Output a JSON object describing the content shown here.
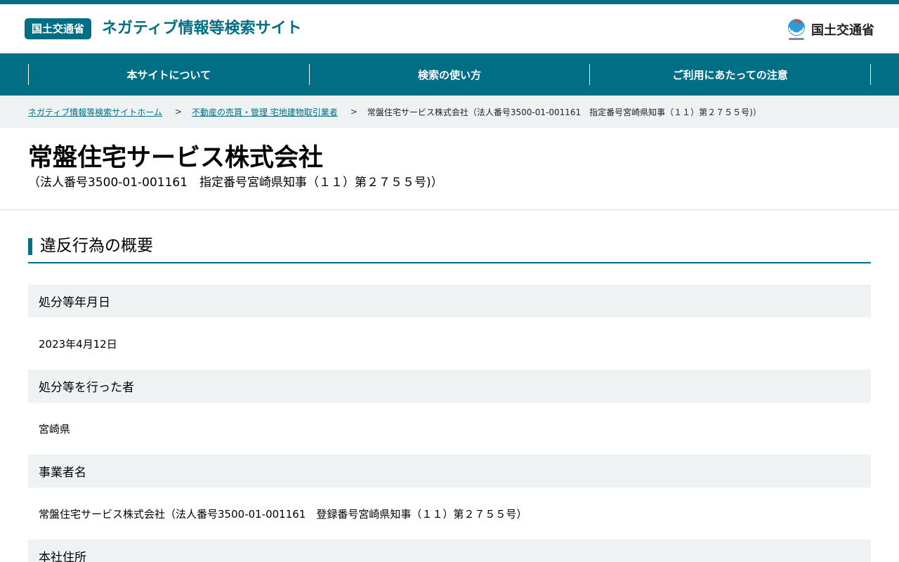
{
  "header": {
    "badge": "国土交通省",
    "site_title": "ネガティブ情報等検索サイト",
    "logo_text": "国土交通省"
  },
  "nav": {
    "items": [
      {
        "label": "本サイトについて"
      },
      {
        "label": "検索の使い方"
      },
      {
        "label": "ご利用にあたっての注意"
      }
    ]
  },
  "breadcrumb": {
    "home": "ネガティブ情報等検索サイトホーム",
    "category": "不動産の売買・管理 宅地建物取引業者",
    "separator": ">",
    "current": "常盤住宅サービス株式会社（法人番号3500-01-001161　指定番号宮崎県知事（１１）第２７５５号)）"
  },
  "company": {
    "name": "常盤住宅サービス株式会社",
    "sub": "（法人番号3500-01-001161　指定番号宮崎県知事（１１）第２７５５号)）"
  },
  "section": {
    "title": "違反行為の概要"
  },
  "fields": [
    {
      "label": "処分等年月日",
      "value": "2023年4月12日"
    },
    {
      "label": "処分等を行った者",
      "value": "宮崎県"
    },
    {
      "label": "事業者名",
      "value": "常盤住宅サービス株式会社（法人番号3500-01-001161　登録番号宮崎県知事（１１）第２７５５号）"
    },
    {
      "label": "本社住所",
      "value": ""
    }
  ],
  "colors": {
    "brand": "#006e84",
    "label_bg": "#eef2f3"
  }
}
